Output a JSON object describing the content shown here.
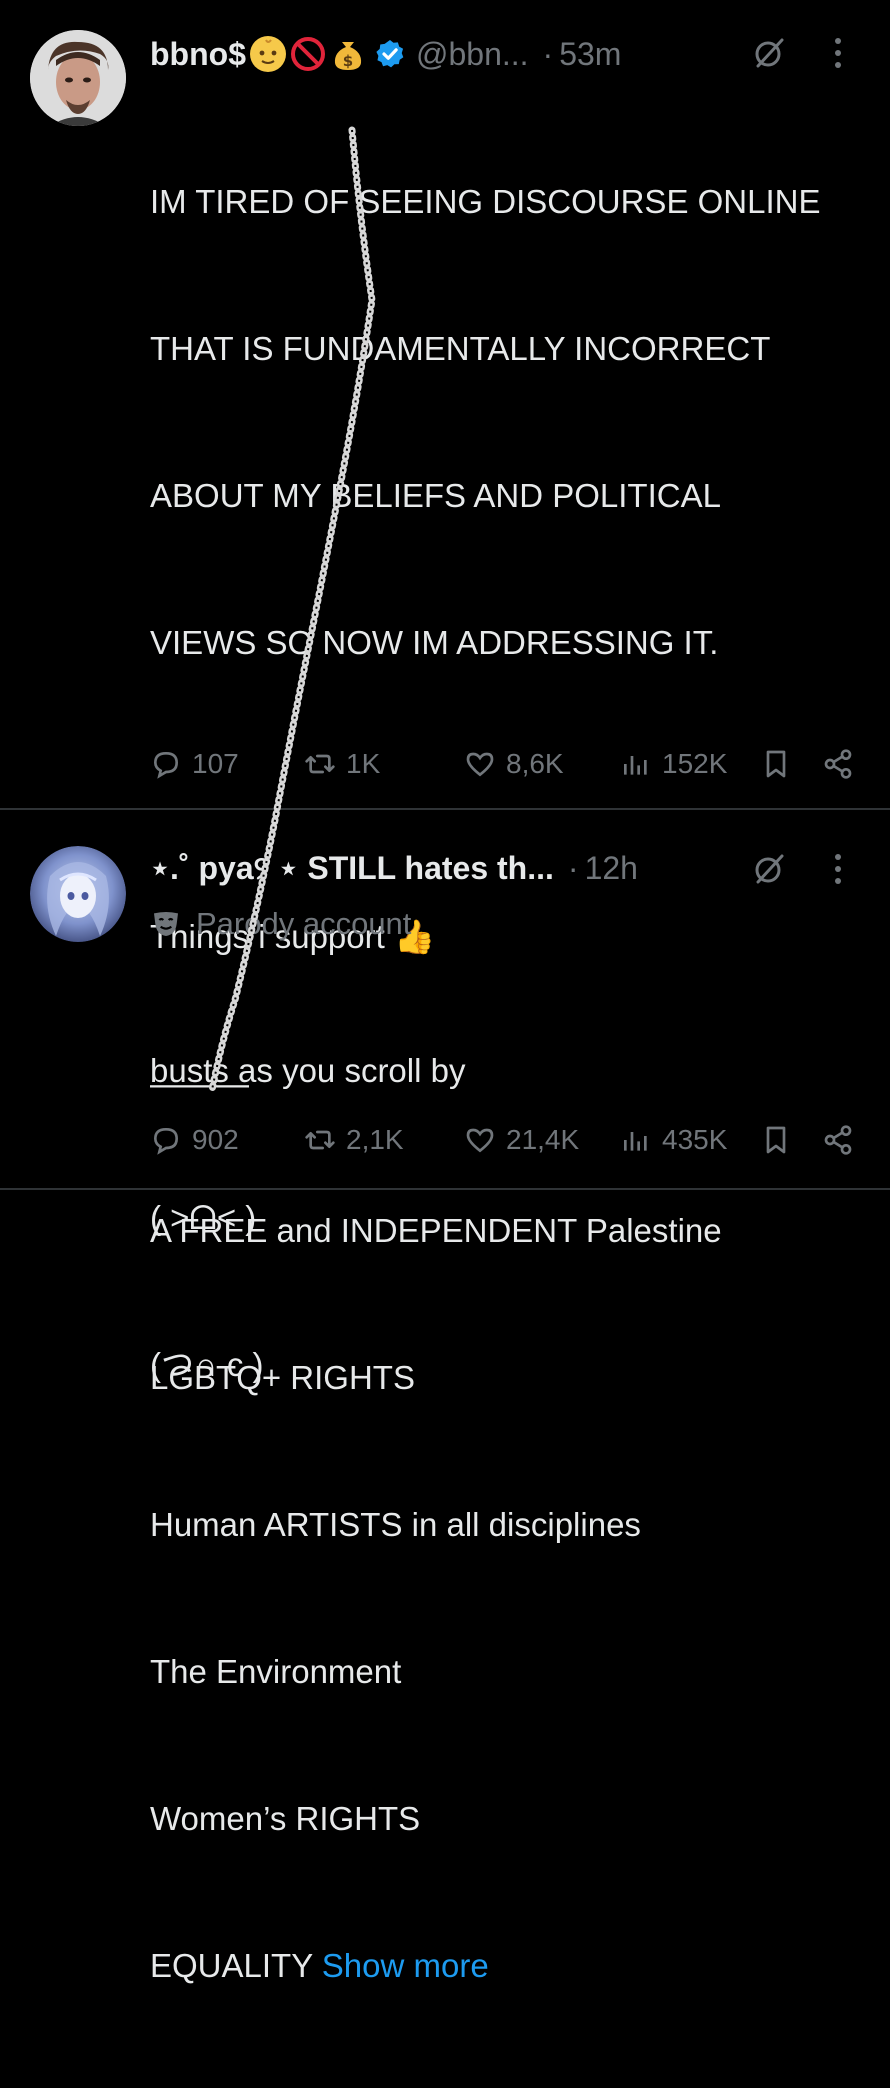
{
  "tweets": [
    {
      "display_name": "bbno$",
      "name_emojis": [
        "baby-emoji",
        "no-entry-emoji",
        "money-bag-emoji"
      ],
      "handle": "@bbn...",
      "time": "53m",
      "text_lines": [
        "IM TIRED OF SEEING DISCOURSE ONLINE",
        "THAT IS FUNDAMENTALLY INCORRECT",
        "ABOUT MY BELIEFS AND POLITICAL",
        "VIEWS SO NOW IM ADDRESSING IT.",
        "",
        "Things i support 👍",
        "———",
        "A FREE and INDEPENDENT Palestine",
        "LGBTQ+ RIGHTS",
        "Human ARTISTS in all disciplines",
        "The Environment",
        "Women’s RIGHTS",
        "EQUALITY"
      ],
      "show_more": "Show more",
      "replies": "107",
      "reposts": "1K",
      "likes": "8,6K",
      "views": "152K"
    },
    {
      "display_name": "⋆.˚ pya୨ ⋆ STILL hates th...",
      "time": "12h",
      "parody_label": "Parody account",
      "text_lines": [
        "busts as you scroll by",
        "( ˃ᗝ˂ )",
        "(つ∩ c )"
      ],
      "replies": "902",
      "reposts": "2,1K",
      "likes": "21,4K",
      "views": "435K"
    }
  ],
  "colors": {
    "background": "#000000",
    "text": "#e7e9ea",
    "muted": "#71767b",
    "link": "#1d9bf0",
    "verified": "#1d9bf0",
    "divider": "#2f3336"
  }
}
